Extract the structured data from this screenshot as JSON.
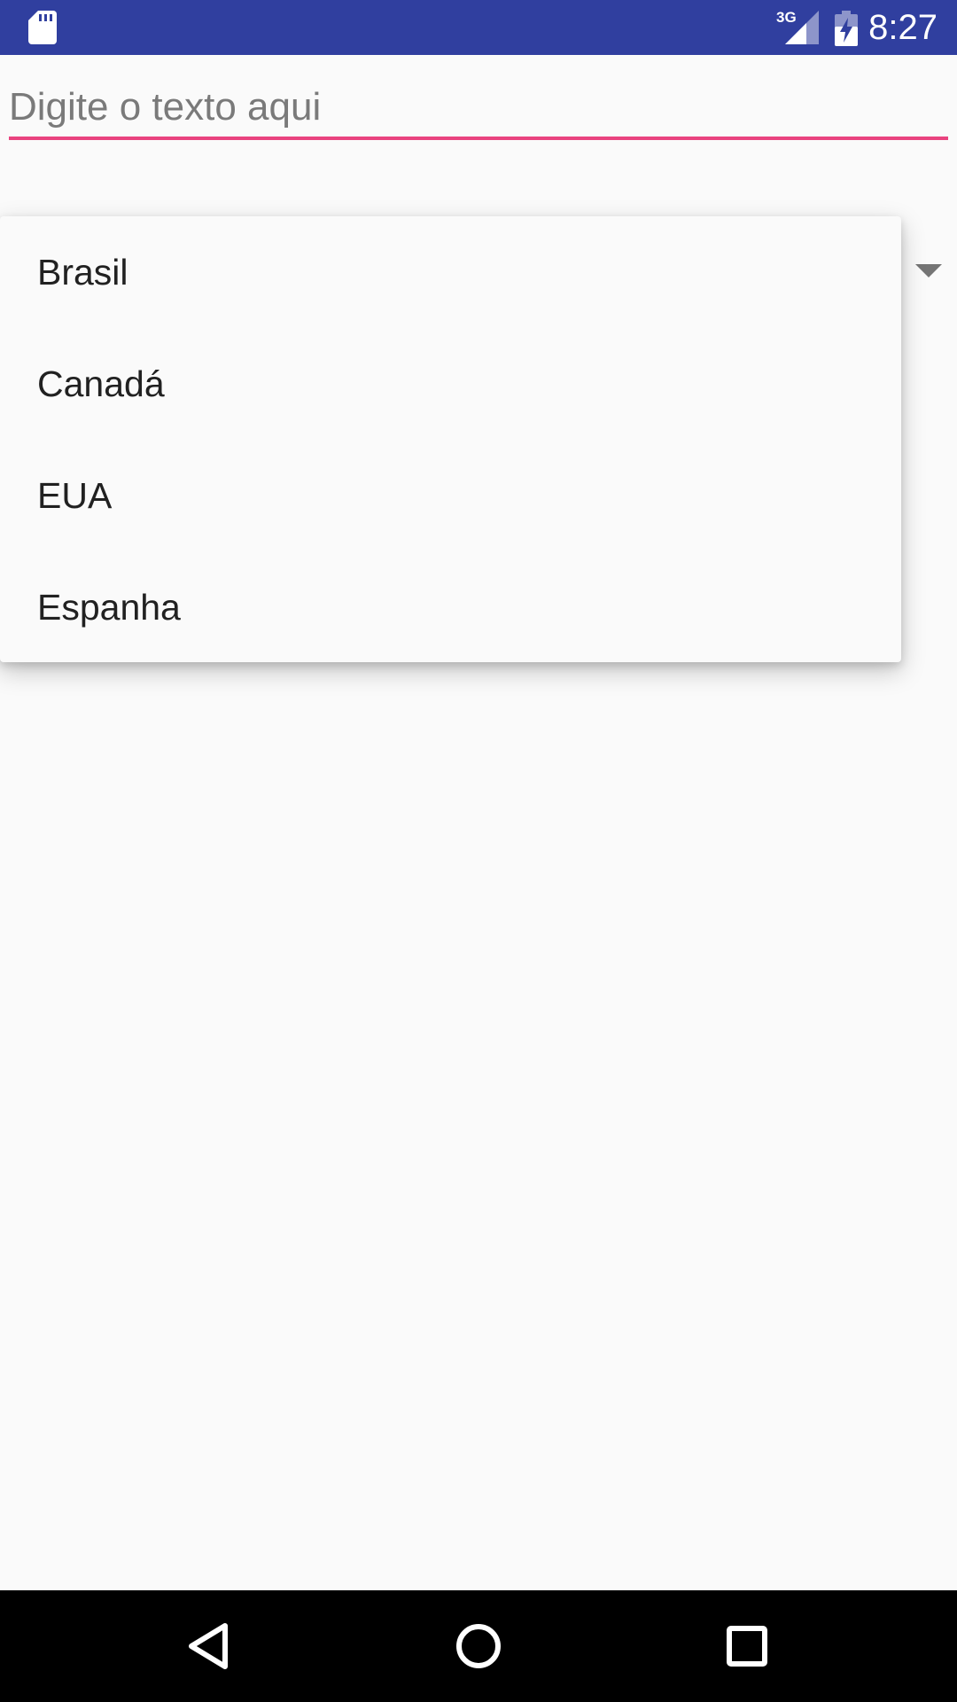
{
  "status_bar": {
    "network_type": "3G",
    "time": "8:27",
    "icons": [
      "sd-card-icon",
      "cell-signal-icon",
      "battery-charging-icon"
    ],
    "background_color": "#303f9f"
  },
  "text_field": {
    "value": "",
    "placeholder": "Digite o texto aqui",
    "accent_color": "#e9437f"
  },
  "spinner": {
    "icon": "dropdown-arrow-icon",
    "options": [
      "Brasil",
      "Canadá",
      "EUA",
      "Espanha"
    ]
  },
  "nav_bar": {
    "icons": [
      "back-icon",
      "home-icon",
      "recents-icon"
    ]
  }
}
